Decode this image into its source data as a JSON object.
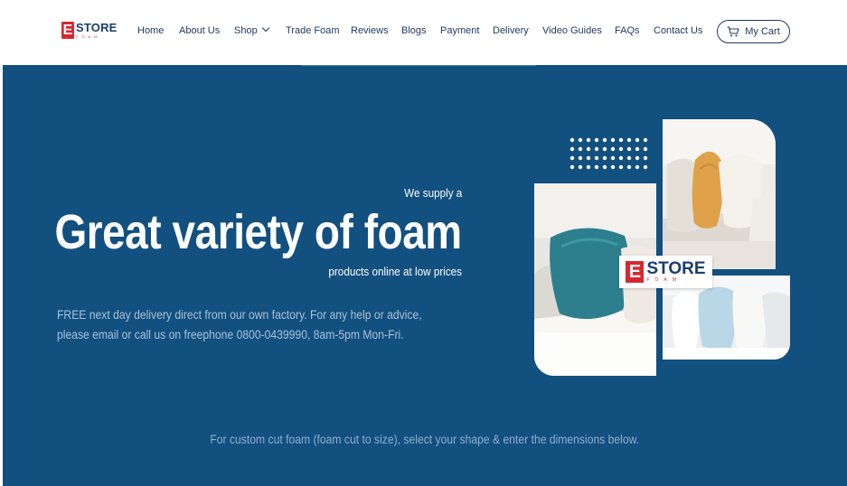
{
  "brand": {
    "logo_letter": "E",
    "logo_name": "STORE",
    "logo_sub": "FOAM"
  },
  "nav": {
    "items": [
      {
        "label": "Home"
      },
      {
        "label": "About Us"
      },
      {
        "label": "Shop",
        "has_dropdown": true
      },
      {
        "label": "Trade Foam"
      },
      {
        "label": "Reviews"
      },
      {
        "label": "Blogs"
      },
      {
        "label": "Payment"
      },
      {
        "label": "Delivery"
      },
      {
        "label": "Video Guides"
      },
      {
        "label": "FAQs"
      },
      {
        "label": "Contact Us"
      }
    ],
    "cart_label": "My Cart",
    "cart_icon": "shopping-cart-icon"
  },
  "hero": {
    "kicker": "We supply a",
    "headline": "Great variety of foam",
    "subline": "products online at low prices",
    "description": "FREE next day delivery direct from our own factory. For any help or advice, please email or call us on freephone 0800-0439990, 8am-5pm Mon-Fri.",
    "custom_note": "For custom cut foam (foam cut to size), select your shape & enter the dimensions below."
  },
  "colors": {
    "hero_bg": "#12507f",
    "brand_red": "#d9272e",
    "brand_navy": "#1b3d6e",
    "nav_text": "#1f3b66"
  }
}
